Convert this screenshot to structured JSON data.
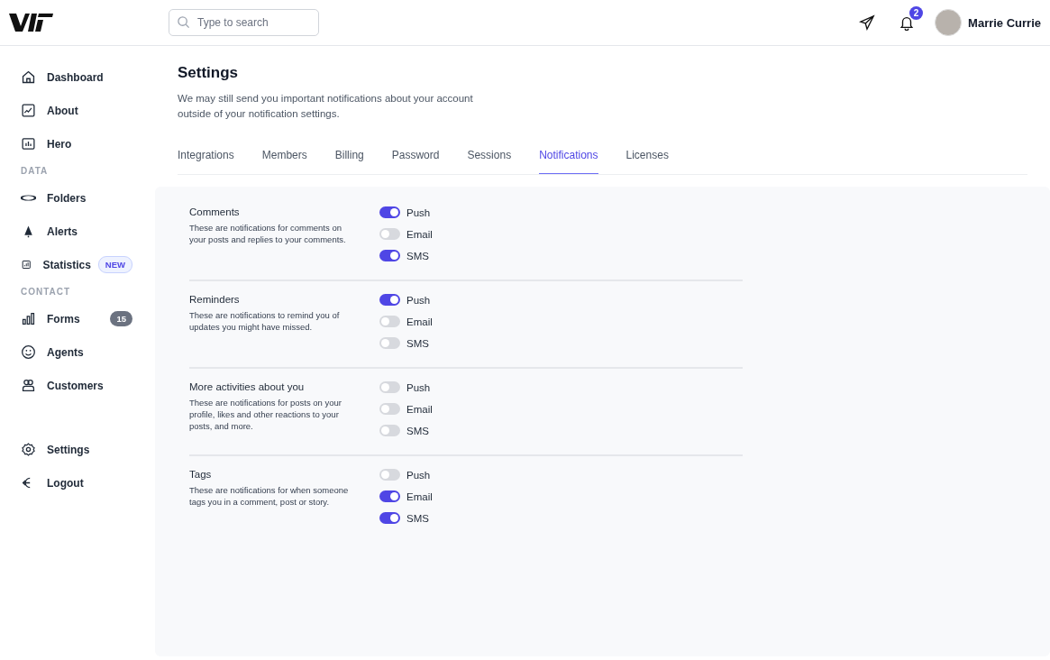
{
  "search": {
    "placeholder": "Type to search"
  },
  "notifications": {
    "count": "2"
  },
  "user": {
    "name": "Marrie Currie"
  },
  "sidebar": {
    "groups": [
      {
        "items": [
          {
            "label": "Dashboard"
          },
          {
            "label": "About"
          },
          {
            "label": "Hero"
          }
        ]
      },
      {
        "heading": "DATA",
        "items": [
          {
            "label": "Folders"
          },
          {
            "label": "Alerts"
          },
          {
            "label": "Statistics",
            "badge": {
              "text": "NEW",
              "kind": "tag"
            }
          }
        ]
      },
      {
        "heading": "CONTACT",
        "items": [
          {
            "label": "Forms",
            "badge": {
              "text": "15",
              "kind": "count"
            }
          },
          {
            "label": "Agents"
          },
          {
            "label": "Customers"
          }
        ]
      }
    ],
    "bottom": [
      {
        "label": "Settings"
      },
      {
        "label": "Logout"
      }
    ]
  },
  "page": {
    "title": "Settings",
    "description": "We may still send you important notifications about your account outside of your notification settings."
  },
  "tabs": [
    {
      "label": "Integrations",
      "selected": false
    },
    {
      "label": "Members",
      "selected": false
    },
    {
      "label": "Billing",
      "selected": false
    },
    {
      "label": "Password",
      "selected": false
    },
    {
      "label": "Sessions",
      "selected": false
    },
    {
      "label": "Notifications",
      "selected": true
    },
    {
      "label": "Licenses",
      "selected": false
    }
  ],
  "sections": [
    {
      "title": "Comments",
      "description": "These are notifications for comments on your posts and replies to your comments.",
      "options": [
        {
          "label": "Push",
          "on": true
        },
        {
          "label": "Email",
          "on": false
        },
        {
          "label": "SMS",
          "on": true
        }
      ]
    },
    {
      "title": "Reminders",
      "description": "These are notifications to remind you of updates you might have missed.",
      "options": [
        {
          "label": "Push",
          "on": true
        },
        {
          "label": "Email",
          "on": false
        },
        {
          "label": "SMS",
          "on": false
        }
      ]
    },
    {
      "title": "More activities about you",
      "description": "These are notifications for posts on your profile, likes and other reactions to your posts, and more.",
      "options": [
        {
          "label": "Push",
          "on": false
        },
        {
          "label": "Email",
          "on": false
        },
        {
          "label": "SMS",
          "on": false
        }
      ]
    },
    {
      "title": "Tags",
      "description": "These are notifications for when someone tags you in a comment, post or story.",
      "options": [
        {
          "label": "Push",
          "on": false
        },
        {
          "label": "Email",
          "on": true
        },
        {
          "label": "SMS",
          "on": true
        }
      ]
    }
  ]
}
